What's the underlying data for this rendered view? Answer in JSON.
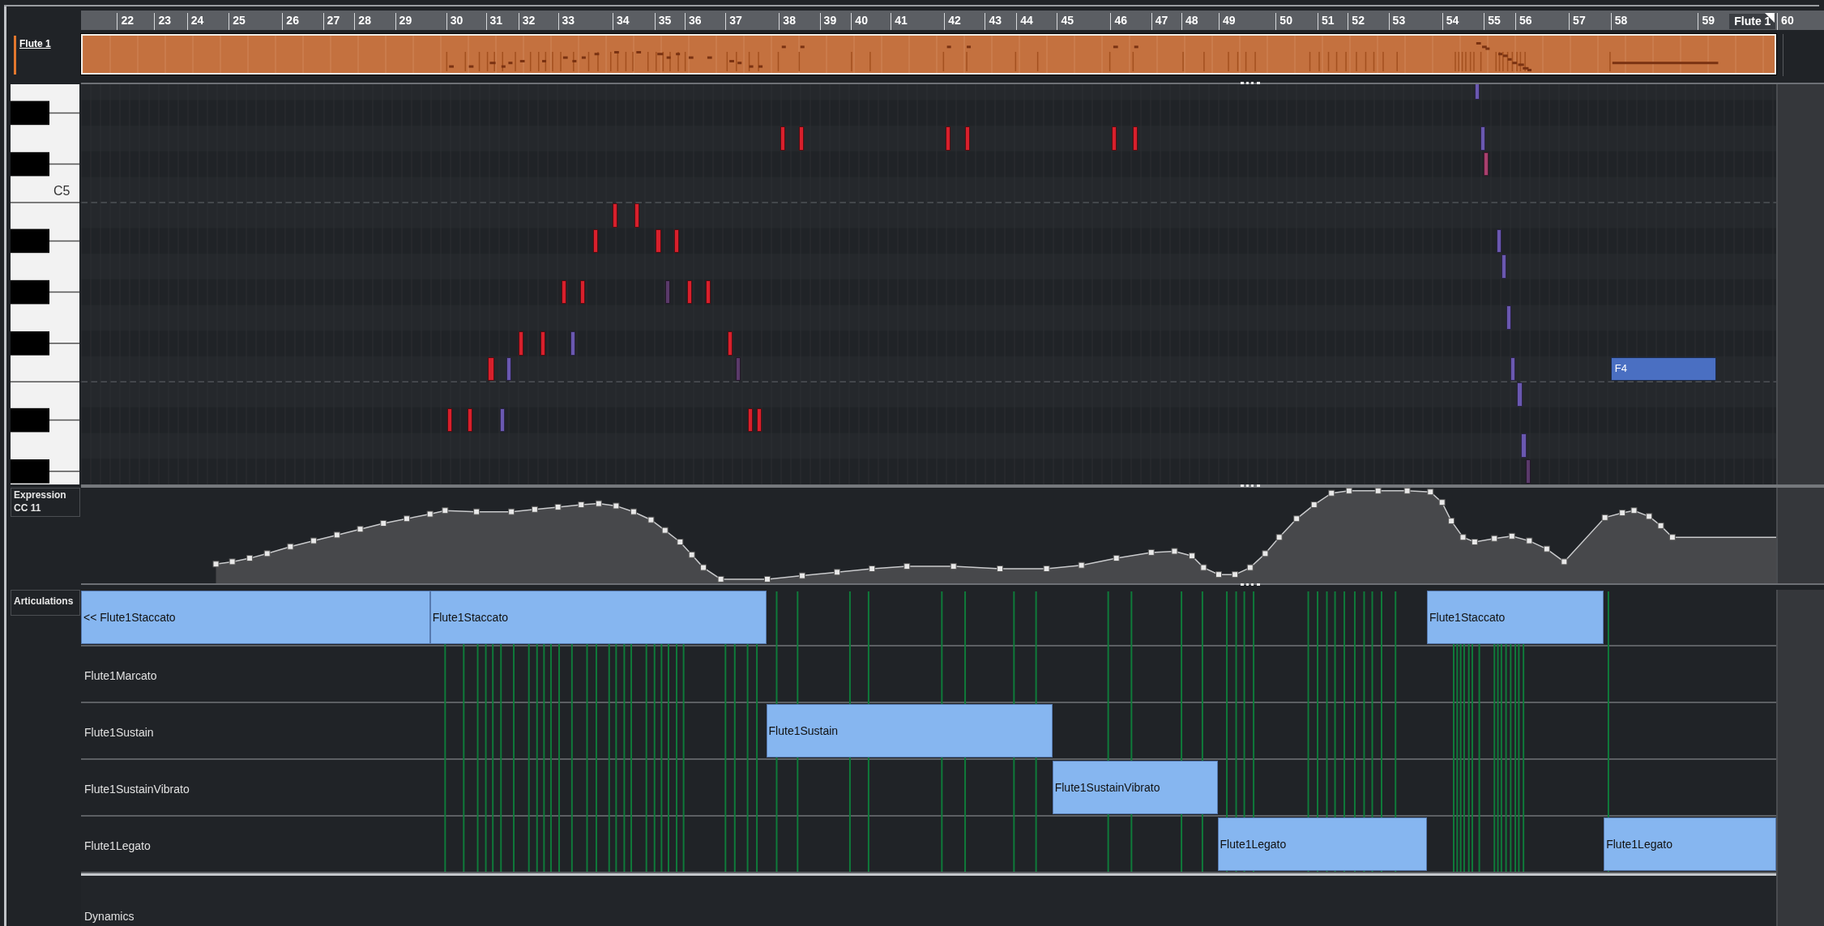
{
  "track": {
    "name": "Flute 1"
  },
  "ruler": {
    "bars": [
      "22",
      "23",
      "24",
      "25",
      "26",
      "27",
      "28",
      "29",
      "30",
      "31",
      "32",
      "33",
      "34",
      "35",
      "36",
      "37",
      "38",
      "39",
      "40",
      "41",
      "42",
      "43",
      "44",
      "45",
      "46",
      "47",
      "48",
      "49",
      "50",
      "51",
      "52",
      "53",
      "54",
      "55",
      "56",
      "57",
      "58",
      "59"
    ],
    "end_bar": "60",
    "part_label": "Flute 1"
  },
  "keyboard": {
    "label": "C5"
  },
  "notes": [
    {
      "color": "#d8202c"
    },
    {
      "color": "#d8202c"
    },
    {
      "color": "#d8202c"
    },
    {
      "color": "#d8202c"
    },
    {
      "color": "#d8202c"
    },
    {
      "color": "#d8202c"
    },
    {
      "color": "#d8202c"
    },
    {
      "color": "#d8202c"
    },
    {
      "color": "#d8202c"
    },
    {
      "color": "#d8202c"
    },
    {
      "color": "#d8202c"
    },
    {
      "color": "#d8202c"
    },
    {
      "color": "#d8202c"
    },
    {
      "color": "#5a3a6a"
    },
    {
      "color": "#d8202c"
    },
    {
      "color": "#d8202c"
    },
    {
      "color": "#d8202c"
    },
    {
      "color": "#d8202c"
    },
    {
      "color": "#6a58b0"
    },
    {
      "color": "#d8202c"
    },
    {
      "color": "#d8202c"
    },
    {
      "color": "#6a58b0"
    },
    {
      "color": "#5a3a6a"
    },
    {
      "color": "#d8202c"
    },
    {
      "color": "#d8202c"
    },
    {
      "color": "#6a58b0"
    },
    {
      "color": "#d8202c"
    },
    {
      "color": "#d8202c"
    },
    {
      "color": "#6a58b0"
    },
    {
      "color": "#6a58b0"
    },
    {
      "color": "#a8406e"
    },
    {
      "color": "#6a58b0"
    },
    {
      "color": "#6a58b0"
    },
    {
      "color": "#6a58b0"
    },
    {
      "color": "#6a58b0"
    },
    {
      "color": "#6a58b0"
    },
    {
      "color": "#6a58b0"
    },
    {
      "color": "#5a3a6a"
    },
    {
      "color": "#4a6fc2",
      "label": "F4"
    }
  ],
  "expression_lane": {
    "title": "Expression",
    "controller": "CC 11"
  },
  "articulations": {
    "title": "Articulations",
    "lanes": [
      {
        "blocks": [
          {
            "label": "<< Flute1Staccato"
          },
          {
            "label": "Flute1Staccato"
          },
          {
            "label": "Flute1Staccato"
          }
        ]
      },
      {
        "name": "Flute1Marcato"
      },
      {
        "name": "Flute1Sustain",
        "blocks": [
          {
            "label": "Flute1Sustain"
          }
        ]
      },
      {
        "name": "Flute1SustainVibrato",
        "blocks": [
          {
            "label": "Flute1SustainVibrato"
          }
        ]
      },
      {
        "name": "Flute1Legato",
        "blocks": [
          {
            "label": "Flute1Legato"
          },
          {
            "label": "Flute1Legato"
          }
        ]
      }
    ]
  },
  "next_lane": {
    "title": "Dynamics"
  }
}
